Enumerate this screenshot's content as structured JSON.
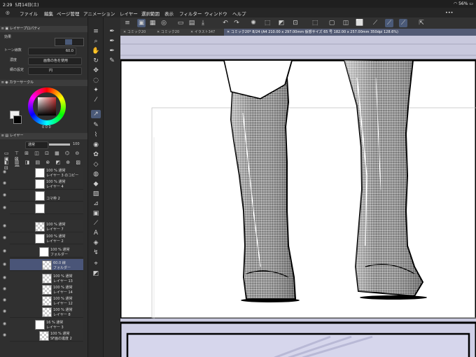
{
  "status": {
    "time": "2:29",
    "date": "5月14日(土)",
    "battery": "56%"
  },
  "menu": {
    "items": [
      "ファイル",
      "編集",
      "ページ管理",
      "アニメーション",
      "レイヤー",
      "選択範囲",
      "表示",
      "フィルター",
      "ウィンドウ",
      "ヘルプ"
    ]
  },
  "tabs": [
    {
      "label": "コミック20"
    },
    {
      "label": "コミック20"
    },
    {
      "label": "イラスト347"
    },
    {
      "label": "コミック20* 8/24 (A4 210.00 x 297.00mm 仮想サイズ 65 号 182.00 x 257.00mm 350dpi 128.6%)"
    }
  ],
  "layer_property": {
    "header": "レイヤープロパティ",
    "effect_label": "効果",
    "tone_density_label": "トーン線数",
    "tone_density_value": "60.0",
    "color_label": "濃度",
    "color_value": "画像の色を使用",
    "shape_label": "網の設定",
    "shape_value": "円"
  },
  "color_circle": {
    "header": "カラーサークル",
    "values": "0  0  0"
  },
  "layer_panel": {
    "header": "レイヤー",
    "blend_mode": "通常",
    "opacity": "100",
    "layers": [
      {
        "pct": "100 %  通常",
        "name": "レイヤー 3 のコピー"
      },
      {
        "pct": "100 %  通常",
        "name": "レイヤー 4"
      },
      {
        "pct": "",
        "name": "コマ枠 2"
      },
      {
        "pct": "",
        "name": ""
      },
      {
        "pct": "100 %  通常",
        "name": "レイヤー 7"
      },
      {
        "pct": "100 %  通常",
        "name": "レイヤー 2"
      },
      {
        "pct": "100 %  通常",
        "name": "フォルダー"
      },
      {
        "pct": "60.0 線",
        "name": "フォルダー"
      },
      {
        "pct": "100 %  通常",
        "name": "レイヤー 13"
      },
      {
        "pct": "100 %  通常",
        "name": "レイヤー 14"
      },
      {
        "pct": "100 %  通常",
        "name": "レイヤー 12"
      },
      {
        "pct": "100 %  通常",
        "name": "レイヤー 8"
      },
      {
        "pct": "16 %  通常",
        "name": "レイヤー 3"
      },
      {
        "pct": "100 %  通常",
        "name": "SF画の進度 2"
      }
    ]
  },
  "colors": {
    "accent": "#4b5a78",
    "canvas_bg": "#c9c9d9",
    "panel": "#2f2f2f"
  }
}
